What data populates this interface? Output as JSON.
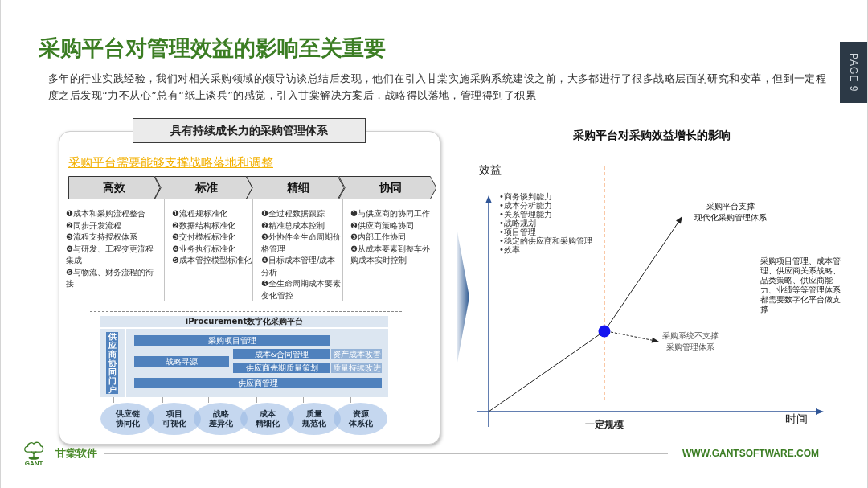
{
  "slide": {
    "title": "采购平台对管理效益的影响至关重要",
    "description": "多年的行业实践经验，我们对相关采购领域的领导访谈总结后发现，他们在引入甘棠实施采购系统建设之前，大多都进行了很多战略层面的研究和变革，但到一定程度之后发现“力不从心”总有“纸上谈兵”的感觉，引入甘棠解决方案后，战略得以落地，管理得到了积累",
    "page_label": "PAGE 9"
  },
  "left_panel": {
    "heading": "具有持续成长力的采购管理体系",
    "subtitle": "采购平台需要能够支撑战略落地和调整",
    "pillars": [
      {
        "label": "高效",
        "items": [
          "❶成本和采购流程整合",
          "❷同步开发流程",
          "❸流程支持授权体系",
          "❹与研发、工程变更流程集成",
          "❺与物流、财务流程的衔接"
        ]
      },
      {
        "label": "标准",
        "items": [
          "❶流程规标准化",
          "❷数据结构标准化",
          "❸交付模板标准化",
          "❹业务执行标准化",
          "❺成本管控模型标准化"
        ]
      },
      {
        "label": "精细",
        "items": [
          "❶全过程数据跟踪",
          "❷精准总成本控制",
          "❸外协件全生命周期价格管理",
          "❹目标成本管理/成本分析",
          "❺全生命周期成本要素变化管控"
        ]
      },
      {
        "label": "协同",
        "items": [
          "❶与供应商的协同工作",
          "❷供应商策略协同",
          "❸内部工作协同",
          "❹从成本要素到整车外购成本实时控制"
        ]
      }
    ],
    "platform": {
      "title": "iProcurement数字化采购平台",
      "portal": "供应商协同门户",
      "modules": [
        {
          "label": "采购项目管理",
          "kind": "core"
        },
        {
          "label": "成本&合同管理",
          "kind": "core"
        },
        {
          "label": "资产成本改善",
          "kind": "improvement"
        },
        {
          "label": "战略寻源",
          "kind": "core"
        },
        {
          "label": "供应商先期质量策划",
          "kind": "core"
        },
        {
          "label": "质量持续改进",
          "kind": "improvement"
        },
        {
          "label": "供应商管理",
          "kind": "core"
        }
      ]
    },
    "outcomes": [
      {
        "lines": [
          "供应链",
          "协同化"
        ]
      },
      {
        "lines": [
          "项目",
          "可视化"
        ]
      },
      {
        "lines": [
          "战略",
          "差异化"
        ]
      },
      {
        "lines": [
          "成本",
          "精细化"
        ]
      },
      {
        "lines": [
          "质量",
          "规范化"
        ]
      },
      {
        "lines": [
          "资源",
          "体系化"
        ]
      }
    ]
  },
  "chart": {
    "title": "采购平台对采购效益增长的影响",
    "y_label": "效益",
    "x_label": "时间",
    "threshold_label": "一定规模",
    "capabilities": [
      "•商务谈判能力",
      "•成本分析能力",
      "•关系管理能力",
      "•战略规划",
      "•项目管理",
      "•稳定的供应商和采购管理",
      "•效率"
    ],
    "supported_label": {
      "lines": [
        "采购平台支撑",
        "现代化采购管理体系"
      ]
    },
    "unsupported_label": {
      "lines": [
        "采购系统不支撑",
        "采购管理体系"
      ]
    },
    "note": "采购项目管理、成本管理、供应商关系战略、品类策略、供应商能力、业绩等等管理体系都需要数字化平台做支撑"
  },
  "footer": {
    "logo_text": "GANT",
    "brand": "甘棠软件",
    "website": "WWW.GANTSOFTWARE.COM"
  }
}
